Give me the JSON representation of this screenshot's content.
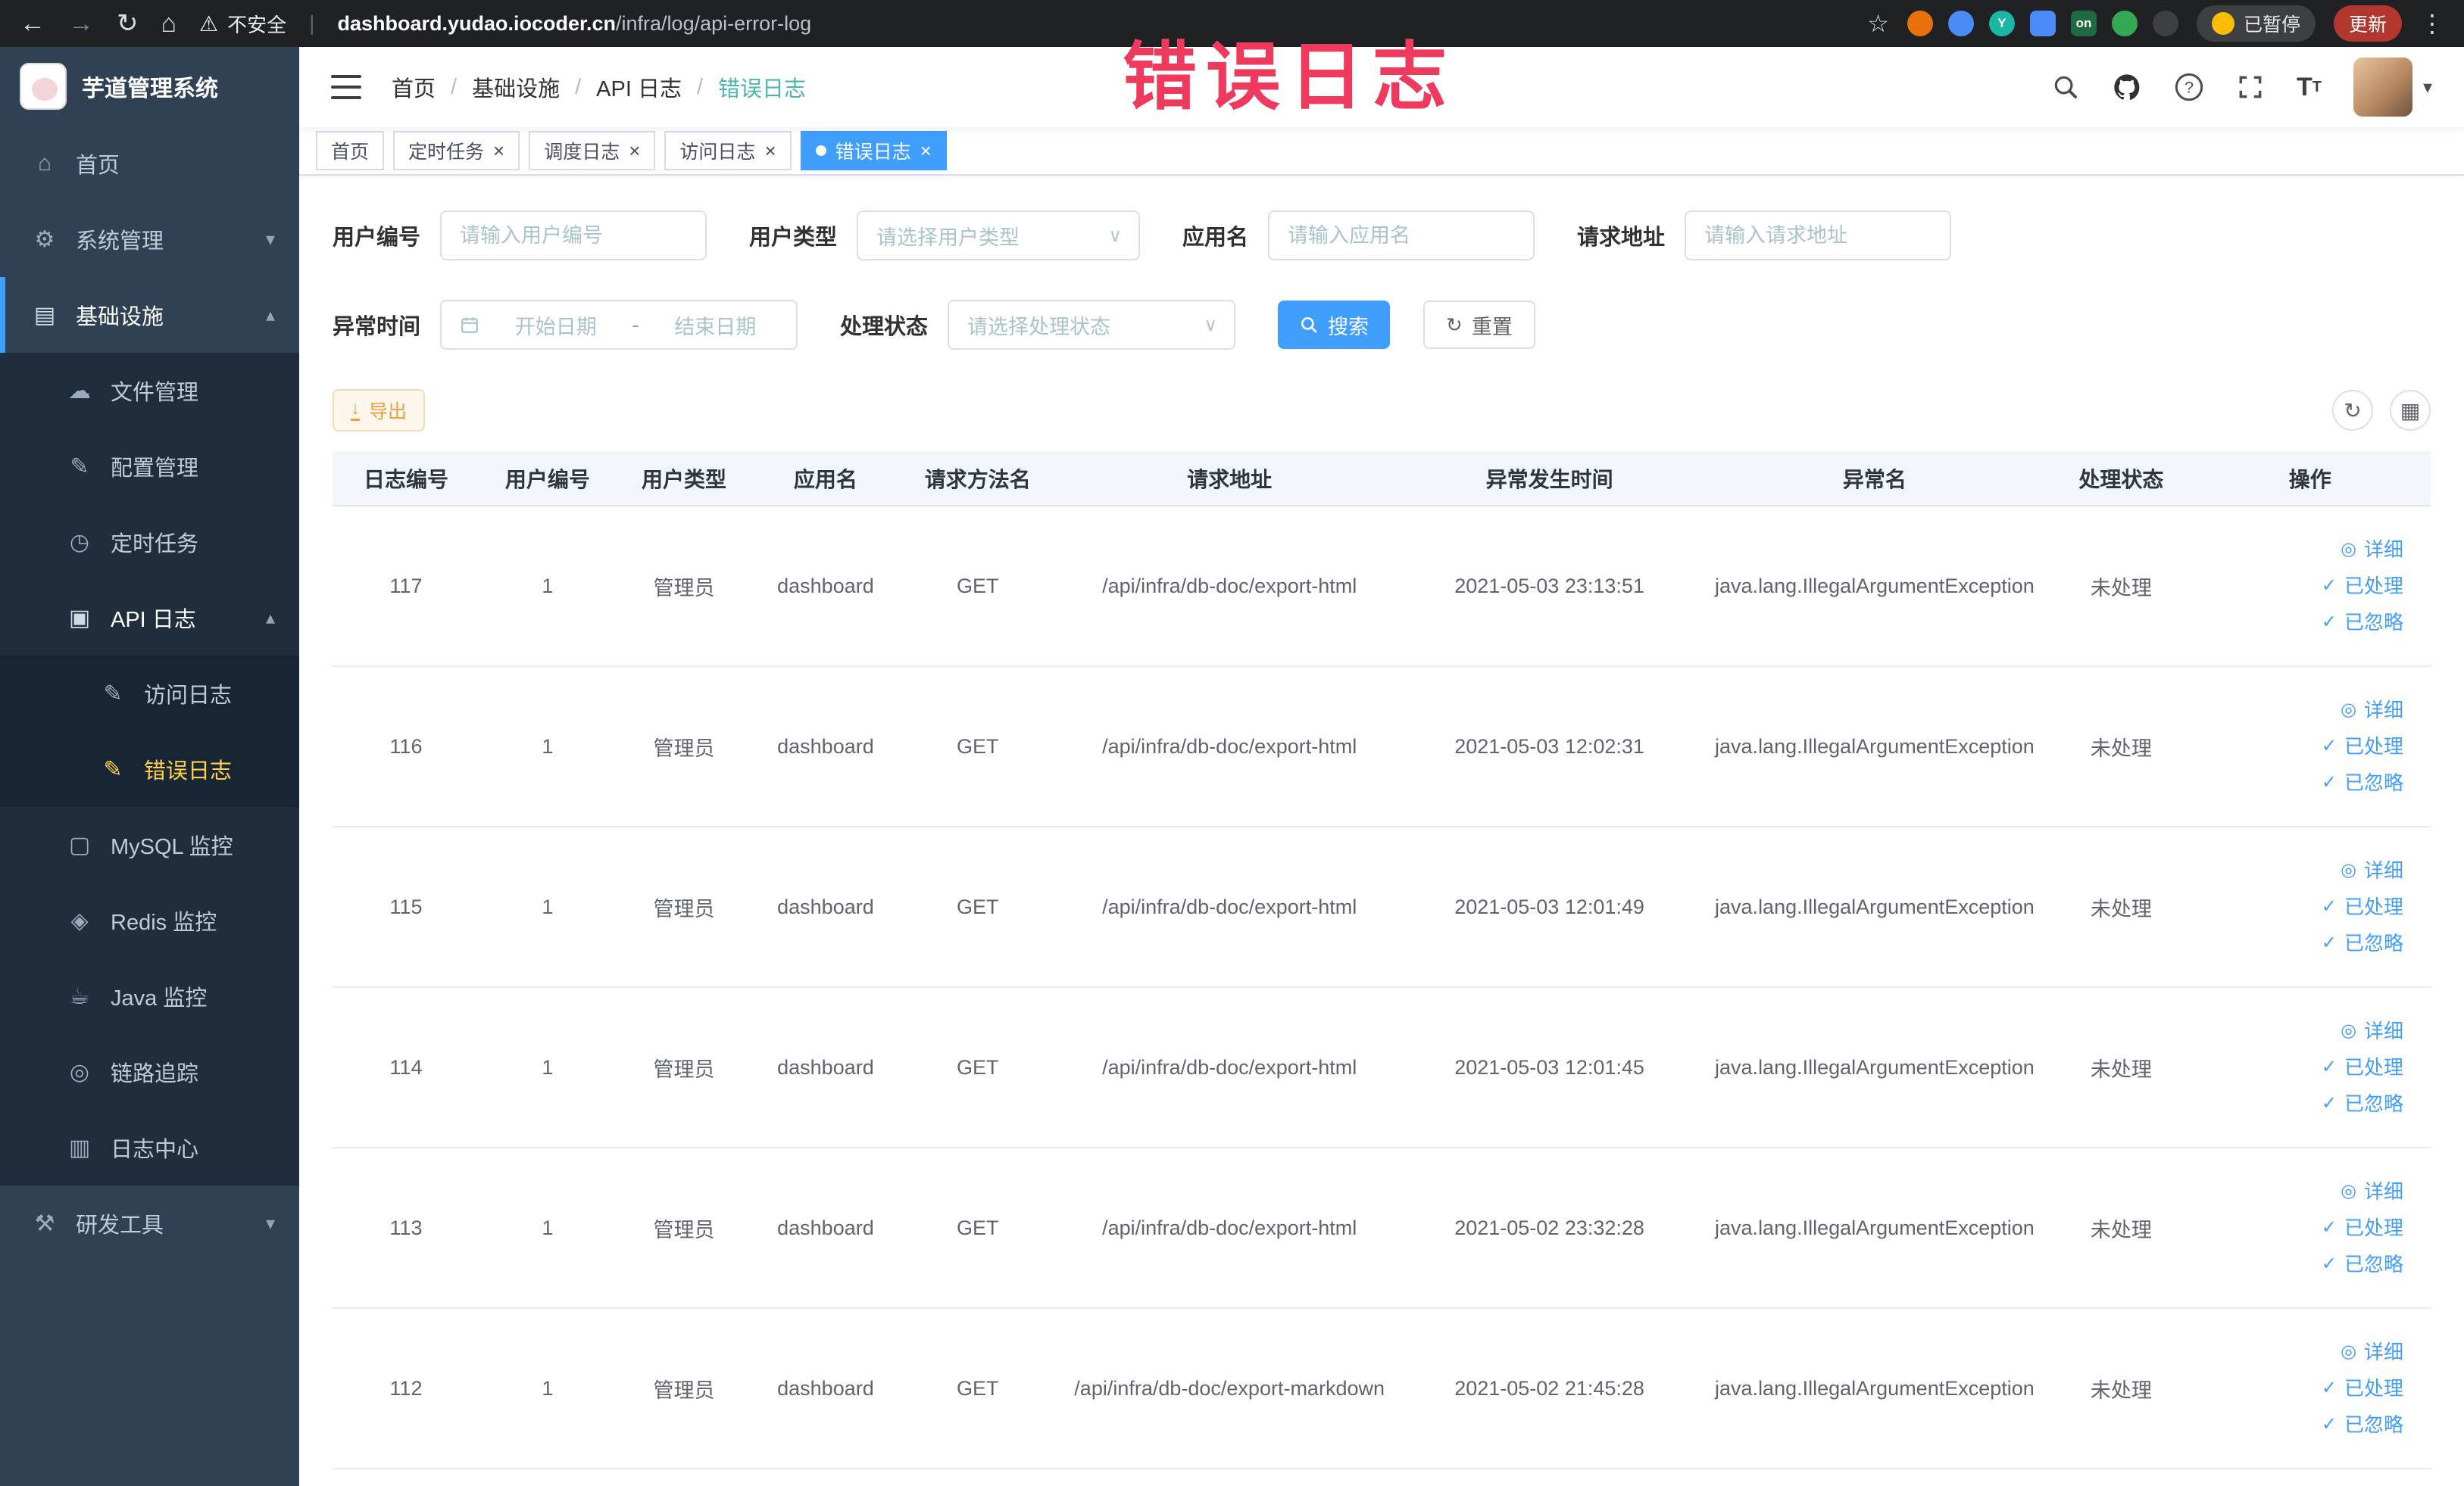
{
  "browser": {
    "security_warning": "不安全",
    "url_host": "dashboard.yudao.iocoder.cn",
    "url_path": "/infra/log/api-error-log",
    "paused_label": "已暂停",
    "update_label": "更新",
    "extensions": [
      {
        "name": "extension-orange-icon",
        "color": "#e8710a",
        "shape": "circle",
        "glyph": ""
      },
      {
        "name": "extension-drop-icon",
        "color": "#4b8bf5",
        "shape": "circle",
        "glyph": ""
      },
      {
        "name": "extension-teal-icon",
        "color": "#18b8a5",
        "shape": "circle",
        "glyph": "Y"
      },
      {
        "name": "extension-grid-icon",
        "color": "#4b8bf5",
        "shape": "square",
        "glyph": ""
      },
      {
        "name": "extension-on-icon",
        "color": "#1e6b43",
        "shape": "square",
        "glyph": "on"
      },
      {
        "name": "extension-leaf-icon",
        "color": "#34a853",
        "shape": "circle",
        "glyph": ""
      },
      {
        "name": "extension-paw-icon",
        "color": "#3c4043",
        "shape": "circle",
        "glyph": ""
      }
    ]
  },
  "icons": {
    "back": "←",
    "forward": "→",
    "reload": "↻",
    "home": "⌂",
    "warning": "⚠",
    "star": "☆",
    "dots": "⋮",
    "separator": "|",
    "chevron_down": "▾",
    "chevron_up": "▴",
    "select_caret": "∨",
    "caret_down": "▾",
    "close": "×",
    "check": "✓",
    "view": "◎",
    "download": "↓",
    "refresh": "↻",
    "grid": "▦"
  },
  "colors": {
    "primary": "#409eff",
    "sidebar_bg": "#304156",
    "active_menu_text": "#ffd04b",
    "export_warning": "#e6a23c",
    "annotation": "#ee3a5c"
  },
  "annotation": {
    "text": "错误日志"
  },
  "sidebar": {
    "logo_title": "芋道管理系统",
    "items": [
      {
        "name": "home",
        "label": "首页",
        "icon": "home-icon",
        "glyph": "⌂",
        "level": 0
      },
      {
        "name": "system-management",
        "label": "系统管理",
        "icon": "gear-icon",
        "glyph": "⚙",
        "level": 0,
        "chevron": "down"
      },
      {
        "name": "infrastructure",
        "label": "基础设施",
        "icon": "grid-icon",
        "glyph": "▤",
        "level": 0,
        "chevron": "up",
        "highlight": true,
        "indicator": true
      },
      {
        "name": "file-management",
        "label": "文件管理",
        "icon": "cloud-icon",
        "glyph": "☁",
        "level": 1
      },
      {
        "name": "config-management",
        "label": "配置管理",
        "icon": "edit-icon",
        "glyph": "✎",
        "level": 1
      },
      {
        "name": "scheduled-tasks",
        "label": "定时任务",
        "icon": "clock-icon",
        "glyph": "◷",
        "level": 1
      },
      {
        "name": "api-logs",
        "label": "API 日志",
        "icon": "document-icon",
        "glyph": "▣",
        "level": 1,
        "chevron": "up",
        "highlight": true
      },
      {
        "name": "access-logs",
        "label": "访问日志",
        "icon": "log-edit-icon",
        "glyph": "✎",
        "level": 2
      },
      {
        "name": "error-logs",
        "label": "错误日志",
        "icon": "log-edit-icon",
        "glyph": "✎",
        "level": 2,
        "active": true
      },
      {
        "name": "mysql-monitor",
        "label": "MySQL 监控",
        "icon": "monitor-icon",
        "glyph": "▢",
        "level": 1
      },
      {
        "name": "redis-monitor",
        "label": "Redis 监控",
        "icon": "layers-icon",
        "glyph": "◈",
        "level": 1
      },
      {
        "name": "java-monitor",
        "label": "Java 监控",
        "icon": "coffee-icon",
        "glyph": "☕",
        "level": 1
      },
      {
        "name": "link-tracing",
        "label": "链路追踪",
        "icon": "eye-icon",
        "glyph": "◎",
        "level": 1
      },
      {
        "name": "log-center",
        "label": "日志中心",
        "icon": "log-icon",
        "glyph": "▥",
        "level": 1
      },
      {
        "name": "dev-tools",
        "label": "研发工具",
        "icon": "tools-icon",
        "glyph": "⚒",
        "level": 0,
        "chevron": "down"
      }
    ]
  },
  "header": {
    "breadcrumb": [
      "首页",
      "基础设施",
      "API 日志",
      "错误日志"
    ],
    "separator": "/"
  },
  "tabs": [
    {
      "name": "home",
      "label": "首页",
      "closable": false,
      "active": false
    },
    {
      "name": "scheduled-tasks",
      "label": "定时任务",
      "closable": true,
      "active": false
    },
    {
      "name": "schedule-log",
      "label": "调度日志",
      "closable": true,
      "active": false
    },
    {
      "name": "api-access-log",
      "label": "访问日志",
      "closable": true,
      "active": false
    },
    {
      "name": "api-error-log",
      "label": "错误日志",
      "closable": true,
      "active": true
    }
  ],
  "filters": {
    "user_id": {
      "label": "用户编号",
      "placeholder": "请输入用户编号"
    },
    "user_type": {
      "label": "用户类型",
      "placeholder": "请选择用户类型"
    },
    "app_name": {
      "label": "应用名",
      "placeholder": "请输入应用名"
    },
    "request_url": {
      "label": "请求地址",
      "placeholder": "请输入请求地址"
    },
    "exception_time": {
      "label": "异常时间",
      "start_placeholder": "开始日期",
      "separator": "-",
      "end_placeholder": "结束日期"
    },
    "process_status": {
      "label": "处理状态",
      "placeholder": "请选择处理状态"
    },
    "search_button": "搜索",
    "reset_button": "重置"
  },
  "toolbar": {
    "export_label": "导出"
  },
  "table": {
    "columns": [
      "日志编号",
      "用户编号",
      "用户类型",
      "应用名",
      "请求方法名",
      "请求地址",
      "异常发生时间",
      "异常名",
      "处理状态",
      "操作"
    ],
    "actions": [
      "详细",
      "已处理",
      "已忽略"
    ],
    "rows": [
      {
        "id": "117",
        "user_id": "1",
        "user_type": "管理员",
        "app": "dashboard",
        "method": "GET",
        "url": "/api/infra/db-doc/export-html",
        "time": "2021-05-03 23:13:51",
        "exception": "java.lang.IllegalArgumentException",
        "status": "未处理"
      },
      {
        "id": "116",
        "user_id": "1",
        "user_type": "管理员",
        "app": "dashboard",
        "method": "GET",
        "url": "/api/infra/db-doc/export-html",
        "time": "2021-05-03 12:02:31",
        "exception": "java.lang.IllegalArgumentException",
        "status": "未处理"
      },
      {
        "id": "115",
        "user_id": "1",
        "user_type": "管理员",
        "app": "dashboard",
        "method": "GET",
        "url": "/api/infra/db-doc/export-html",
        "time": "2021-05-03 12:01:49",
        "exception": "java.lang.IllegalArgumentException",
        "status": "未处理"
      },
      {
        "id": "114",
        "user_id": "1",
        "user_type": "管理员",
        "app": "dashboard",
        "method": "GET",
        "url": "/api/infra/db-doc/export-html",
        "time": "2021-05-03 12:01:45",
        "exception": "java.lang.IllegalArgumentException",
        "status": "未处理"
      },
      {
        "id": "113",
        "user_id": "1",
        "user_type": "管理员",
        "app": "dashboard",
        "method": "GET",
        "url": "/api/infra/db-doc/export-html",
        "time": "2021-05-02 23:32:28",
        "exception": "java.lang.IllegalArgumentException",
        "status": "未处理"
      },
      {
        "id": "112",
        "user_id": "1",
        "user_type": "管理员",
        "app": "dashboard",
        "method": "GET",
        "url": "/api/infra/db-doc/export-markdown",
        "time": "2021-05-02 21:45:28",
        "exception": "java.lang.IllegalArgumentException",
        "status": "未处理"
      }
    ]
  }
}
